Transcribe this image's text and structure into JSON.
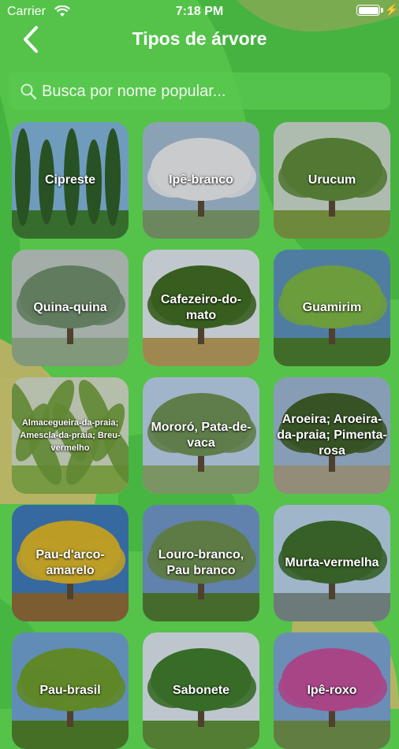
{
  "status_bar": {
    "carrier": "Carrier",
    "time": "7:18 PM",
    "battery_level": 1.0
  },
  "nav": {
    "title": "Tipos de árvore"
  },
  "search": {
    "placeholder": "Busca por nome popular...",
    "value": ""
  },
  "colors": {
    "background_green": "#55c24a",
    "blob_tan": "#c9b06a",
    "blob_dark_green": "#3aa83a"
  },
  "trees": [
    {
      "name": "Cipreste"
    },
    {
      "name": "Ipê-branco"
    },
    {
      "name": "Urucum"
    },
    {
      "name": "Quina-quina"
    },
    {
      "name": "Cafezeiro-do-mato"
    },
    {
      "name": "Guamirim"
    },
    {
      "name": "Almacegueira-da-praia; Amescla-da-praia; Breu-vermelho"
    },
    {
      "name": "Mororó, Pata-de-vaca"
    },
    {
      "name": "Aroeira; Aroeira-da-praia; Pimenta-rosa"
    },
    {
      "name": "Pau-d'arco-amarelo"
    },
    {
      "name": "Louro-branco, Pau branco"
    },
    {
      "name": "Murta-vermelha"
    },
    {
      "name": "Pau-brasil"
    },
    {
      "name": "Sabonete"
    },
    {
      "name": "Ipê-roxo"
    }
  ]
}
